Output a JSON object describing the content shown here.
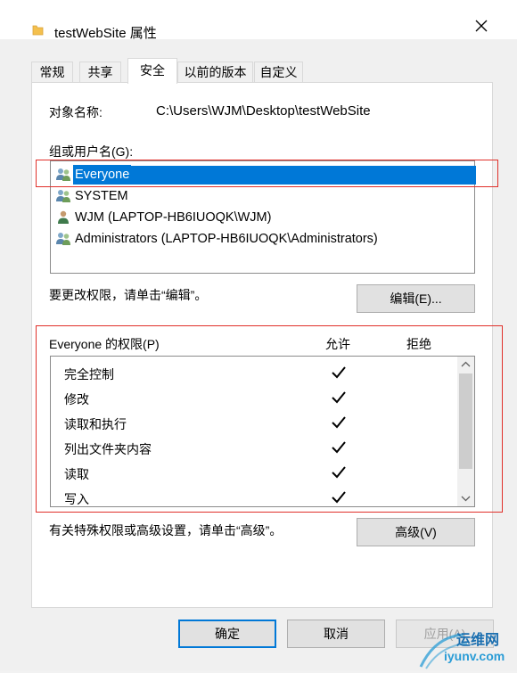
{
  "window": {
    "title": "testWebSite 属性",
    "close_icon": "close-icon",
    "folder_icon": "folder-icon"
  },
  "tabs": [
    {
      "label": "常规",
      "active": false
    },
    {
      "label": "共享",
      "active": false
    },
    {
      "label": "安全",
      "active": true
    },
    {
      "label": "以前的版本",
      "active": false
    },
    {
      "label": "自定义",
      "active": false
    }
  ],
  "security": {
    "object_name_label": "对象名称:",
    "object_name_value": "C:\\Users\\WJM\\Desktop\\testWebSite",
    "groups_label": "组或用户名(G):",
    "users": [
      {
        "name": "Everyone",
        "icon": "user-group-icon",
        "selected": true
      },
      {
        "name": "SYSTEM",
        "icon": "user-group-icon",
        "selected": false
      },
      {
        "name": "WJM (LAPTOP-HB6IUOQK\\WJM)",
        "icon": "user-icon",
        "selected": false
      },
      {
        "name": "Administrators (LAPTOP-HB6IUOQK\\Administrators)",
        "icon": "user-group-icon",
        "selected": false
      }
    ],
    "edit_hint": "要更改权限，请单击“编辑”。",
    "edit_button": "编辑(E)...",
    "permissions_label": "Everyone 的权限(P)",
    "allow_header": "允许",
    "deny_header": "拒绝",
    "permissions": [
      {
        "name": "完全控制",
        "allow": true,
        "deny": false
      },
      {
        "name": "修改",
        "allow": true,
        "deny": false
      },
      {
        "name": "读取和执行",
        "allow": true,
        "deny": false
      },
      {
        "name": "列出文件夹内容",
        "allow": true,
        "deny": false
      },
      {
        "name": "读取",
        "allow": true,
        "deny": false
      },
      {
        "name": "写入",
        "allow": true,
        "deny": false
      }
    ],
    "advanced_hint": "有关特殊权限或高级设置，请单击“高级”。",
    "advanced_button": "高级(V)"
  },
  "footer": {
    "ok_button": "确定",
    "cancel_button": "取消",
    "apply_button": "应用(A)"
  },
  "watermark": {
    "text": "运维网",
    "url": "iyunv.com"
  },
  "colors": {
    "selection": "#0078d7",
    "highlight_box": "#e0302a"
  }
}
